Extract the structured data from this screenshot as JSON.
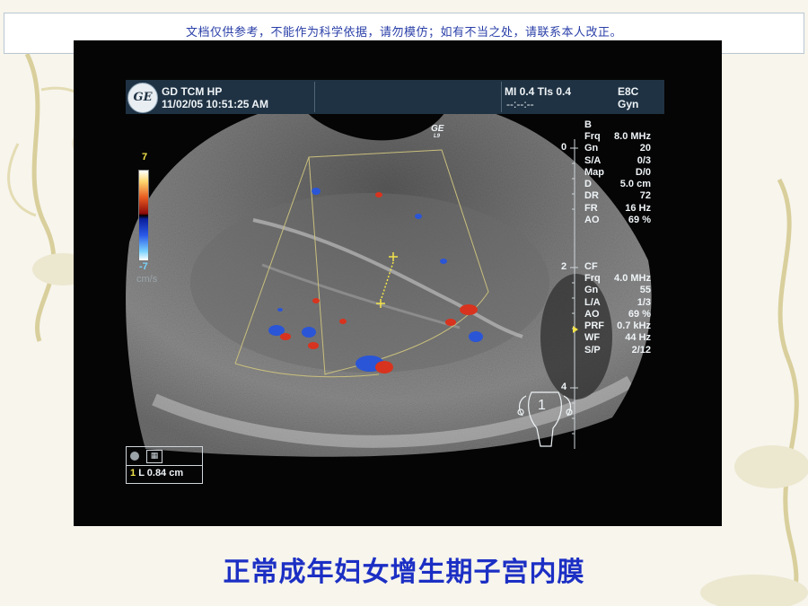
{
  "notice": {
    "text": "文档仅供参考，不能作为科学依据，请勿模仿；如有不当之处，请联系本人改正。"
  },
  "scan_header": {
    "logo": "GE",
    "site": "GD TCM HP",
    "datetime": "11/02/05 10:51:25 AM",
    "mi_tis": "MI 0.4   TIs 0.4",
    "probe": "E8C",
    "timer": "--:--:--",
    "preset": "Gyn",
    "probe_mark": "GE",
    "probe_mark_sub": "L9"
  },
  "bmode": {
    "title": "B",
    "params": [
      {
        "k": "Frq",
        "v": "8.0 MHz"
      },
      {
        "k": "Gn",
        "v": "20"
      },
      {
        "k": "S/A",
        "v": "0/3"
      },
      {
        "k": "Map",
        "v": "D/0"
      },
      {
        "k": "D",
        "v": "5.0 cm"
      },
      {
        "k": "DR",
        "v": "72"
      },
      {
        "k": "FR",
        "v": "16 Hz"
      },
      {
        "k": "AO",
        "v": "69 %"
      }
    ]
  },
  "cf": {
    "title": "CF",
    "params": [
      {
        "k": "Frq",
        "v": "4.0 MHz"
      },
      {
        "k": "Gn",
        "v": "55"
      },
      {
        "k": "L/A",
        "v": "1/3"
      },
      {
        "k": "AO",
        "v": "69 %"
      },
      {
        "k": "PRF",
        "v": "0.7 kHz"
      },
      {
        "k": "WF",
        "v": "44 Hz"
      },
      {
        "k": "S/P",
        "v": "2/12"
      }
    ]
  },
  "depth_ruler": {
    "labels": [
      "0",
      "2",
      "4"
    ]
  },
  "colorbar": {
    "top": "7",
    "bottom": "-7",
    "unit": "cm/s"
  },
  "measurement": {
    "index": "1",
    "label": "L  0.84 cm"
  },
  "body_marker": {
    "label": "1"
  },
  "caption": {
    "text": "正常成年妇女增生期子宫内膜"
  },
  "colors": {
    "caption": "#1c2fc4",
    "notice_text": "#2a3fa8",
    "header_band": "#1f3243",
    "caliper": "#f2e34a",
    "doppler_red": "#d8331e",
    "doppler_blue": "#2a55d6"
  }
}
